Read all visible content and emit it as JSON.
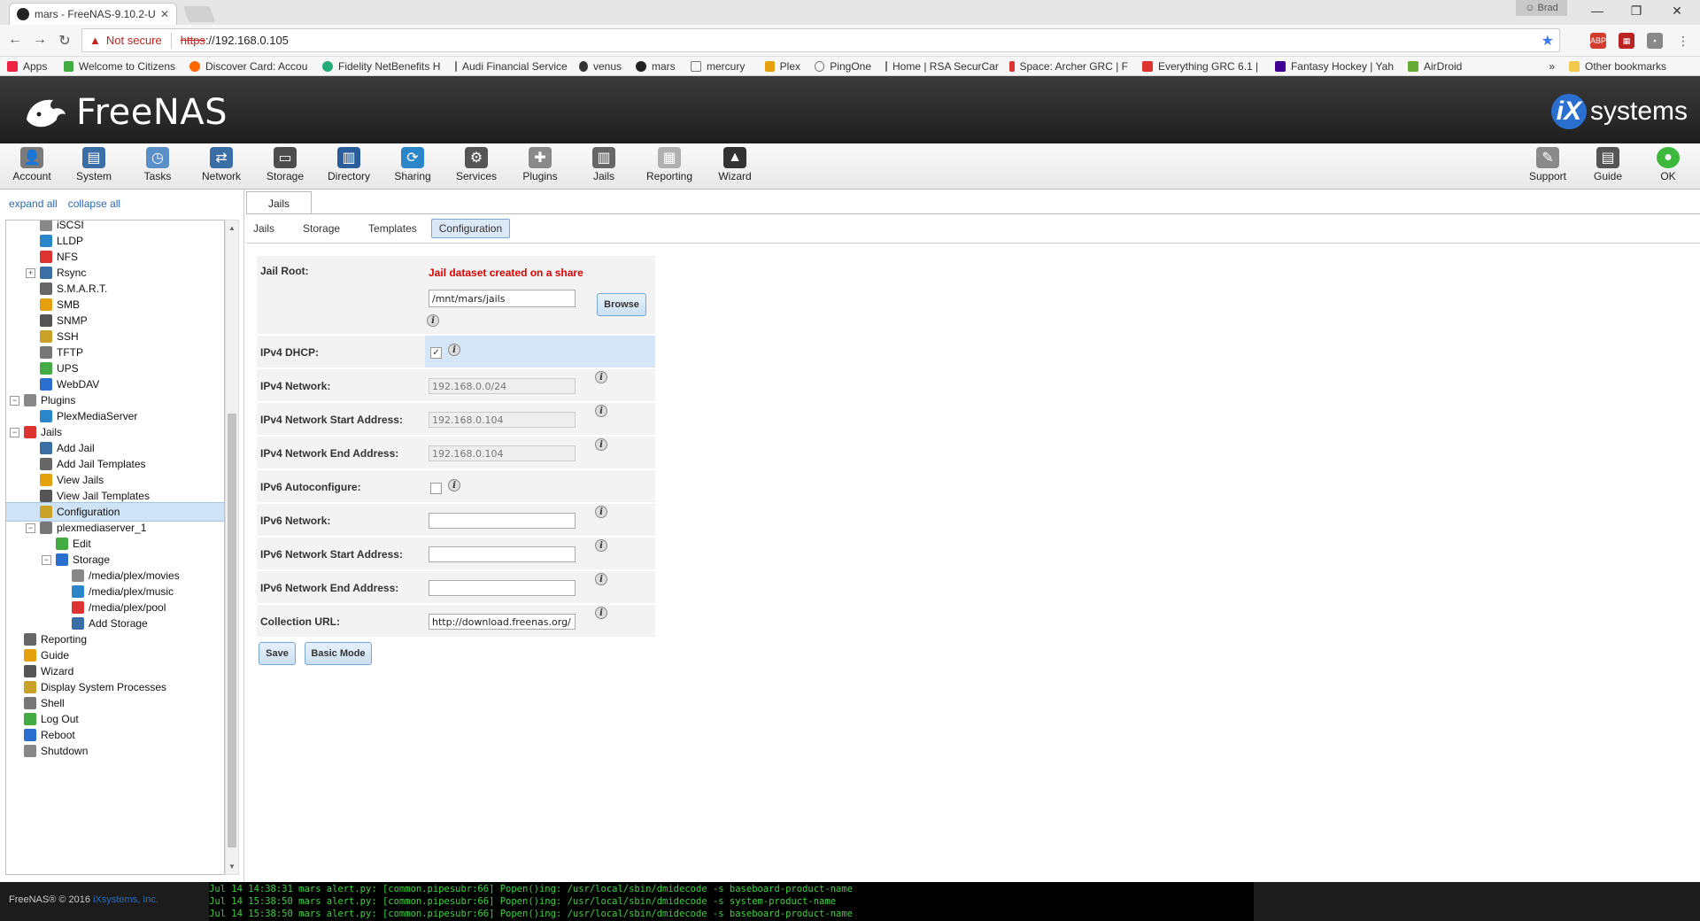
{
  "browser": {
    "tab_title": "mars - FreeNAS-9.10.2-U",
    "profile_name": "Brad",
    "security_label": "Not secure",
    "url_scheme": "https",
    "url_rest": "://192.168.0.105",
    "bookmarks": [
      {
        "label": "Apps"
      },
      {
        "label": "Welcome to Citizens"
      },
      {
        "label": "Discover Card: Accou"
      },
      {
        "label": "Fidelity NetBenefits H"
      },
      {
        "label": "Audi Financial Service"
      },
      {
        "label": "venus"
      },
      {
        "label": "mars"
      },
      {
        "label": "mercury"
      },
      {
        "label": "Plex"
      },
      {
        "label": "PingOne"
      },
      {
        "label": "Home | RSA SecurCar"
      },
      {
        "label": "Space: Archer GRC | F"
      },
      {
        "label": "Everything GRC 6.1 |"
      },
      {
        "label": "Fantasy Hockey | Yah"
      },
      {
        "label": "AirDroid"
      }
    ],
    "bookmarks_overflow": "»",
    "other_bookmarks": "Other bookmarks"
  },
  "header": {
    "product": "FreeNAS",
    "vendor": "systems",
    "vendor_mark": "iX"
  },
  "toolbar": {
    "left": [
      {
        "label": "Account",
        "color": "#7a7a7a"
      },
      {
        "label": "System",
        "color": "#3a6ea5"
      },
      {
        "label": "Tasks",
        "color": "#5b8fc7"
      },
      {
        "label": "Network",
        "color": "#3a6ea5"
      },
      {
        "label": "Storage",
        "color": "#4d4d4d"
      },
      {
        "label": "Directory",
        "color": "#2a5d9a"
      },
      {
        "label": "Sharing",
        "color": "#2a86c9"
      },
      {
        "label": "Services",
        "color": "#555555"
      },
      {
        "label": "Plugins",
        "color": "#8a8a8a"
      },
      {
        "label": "Jails",
        "color": "#666666"
      },
      {
        "label": "Reporting",
        "color": "#b0b0b0"
      },
      {
        "label": "Wizard",
        "color": "#333333"
      }
    ],
    "right": [
      {
        "label": "Support",
        "color": "#8a8a8a"
      },
      {
        "label": "Guide",
        "color": "#555555"
      },
      {
        "label": "OK",
        "color": "#3cb93c"
      }
    ]
  },
  "sidebar": {
    "expand_all": "expand all",
    "collapse_all": "collapse all",
    "tree": [
      {
        "label": "iSCSI",
        "indent": 2
      },
      {
        "label": "LLDP",
        "indent": 2
      },
      {
        "label": "NFS",
        "indent": 2
      },
      {
        "label": "Rsync",
        "indent": 2,
        "expander": "+"
      },
      {
        "label": "S.M.A.R.T.",
        "indent": 2
      },
      {
        "label": "SMB",
        "indent": 2
      },
      {
        "label": "SNMP",
        "indent": 2
      },
      {
        "label": "SSH",
        "indent": 2
      },
      {
        "label": "TFTP",
        "indent": 2
      },
      {
        "label": "UPS",
        "indent": 2
      },
      {
        "label": "WebDAV",
        "indent": 2
      },
      {
        "label": "Plugins",
        "indent": 1,
        "expander": "−"
      },
      {
        "label": "PlexMediaServer",
        "indent": 2
      },
      {
        "label": "Jails",
        "indent": 1,
        "expander": "−"
      },
      {
        "label": "Add Jail",
        "indent": 2
      },
      {
        "label": "Add Jail Templates",
        "indent": 2
      },
      {
        "label": "View Jails",
        "indent": 2
      },
      {
        "label": "View Jail Templates",
        "indent": 2
      },
      {
        "label": "Configuration",
        "indent": 2,
        "selected": true
      },
      {
        "label": "plexmediaserver_1",
        "indent": 2,
        "expander": "−"
      },
      {
        "label": "Edit",
        "indent": 3
      },
      {
        "label": "Storage",
        "indent": 3,
        "expander": "−"
      },
      {
        "label": "/media/plex/movies",
        "indent": 4
      },
      {
        "label": "/media/plex/music",
        "indent": 4
      },
      {
        "label": "/media/plex/pool",
        "indent": 4
      },
      {
        "label": "Add Storage",
        "indent": 4
      },
      {
        "label": "Reporting",
        "indent": 1
      },
      {
        "label": "Guide",
        "indent": 1
      },
      {
        "label": "Wizard",
        "indent": 1
      },
      {
        "label": "Display System Processes",
        "indent": 1
      },
      {
        "label": "Shell",
        "indent": 1
      },
      {
        "label": "Log Out",
        "indent": 1
      },
      {
        "label": "Reboot",
        "indent": 1
      },
      {
        "label": "Shutdown",
        "indent": 1
      }
    ]
  },
  "main": {
    "top_tab": "Jails",
    "subtabs": [
      "Jails",
      "Storage",
      "Templates",
      "Configuration"
    ],
    "active_subtab": "Configuration",
    "form": {
      "jail_root_label": "Jail Root:",
      "jail_root_error": "Jail dataset created on a share",
      "jail_root_value": "/mnt/mars/jails",
      "browse_label": "Browse",
      "ipv4_dhcp_label": "IPv4 DHCP:",
      "ipv4_dhcp_checked": true,
      "ipv4_network_label": "IPv4 Network:",
      "ipv4_network_value": "192.168.0.0/24",
      "ipv4_start_label": "IPv4 Network Start Address:",
      "ipv4_start_value": "192.168.0.104",
      "ipv4_end_label": "IPv4 Network End Address:",
      "ipv4_end_value": "192.168.0.104",
      "ipv6_auto_label": "IPv6 Autoconfigure:",
      "ipv6_auto_checked": false,
      "ipv6_network_label": "IPv6 Network:",
      "ipv6_network_value": "",
      "ipv6_start_label": "IPv6 Network Start Address:",
      "ipv6_start_value": "",
      "ipv6_end_label": "IPv6 Network End Address:",
      "ipv6_end_value": "",
      "collection_url_label": "Collection URL:",
      "collection_url_value": "http://download.freenas.org/",
      "save_label": "Save",
      "basic_mode_label": "Basic Mode"
    }
  },
  "footer": {
    "copyright_prefix": "FreeNAS® © 2016",
    "copyright_company": "iXsystems, Inc.",
    "console_lines": [
      "Jul 14 14:38:31 mars alert.py: [common.pipesubr:66] Popen()ing: /usr/local/sbin/dmidecode -s baseboard-product-name",
      "Jul 14 15:38:50 mars alert.py: [common.pipesubr:66] Popen()ing: /usr/local/sbin/dmidecode -s system-product-name",
      "Jul 14 15:38:50 mars alert.py: [common.pipesubr:66] Popen()ing: /usr/local/sbin/dmidecode -s baseboard-product-name"
    ]
  }
}
